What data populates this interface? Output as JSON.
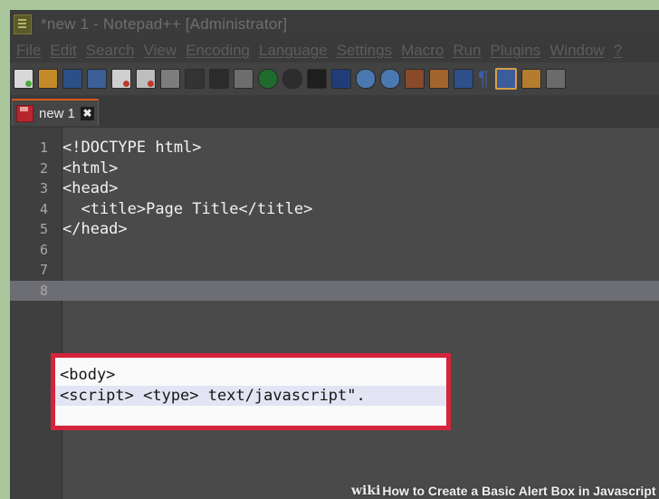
{
  "window": {
    "title": "*new 1 - Notepad++ [Administrator]"
  },
  "menu": [
    "File",
    "Edit",
    "Search",
    "View",
    "Encoding",
    "Language",
    "Settings",
    "Macro",
    "Run",
    "Plugins",
    "Window",
    "?"
  ],
  "toolbar": {
    "icons": [
      "new-file-icon",
      "open-file-icon",
      "save-icon",
      "save-all-icon",
      "close-icon",
      "close-all-icon",
      "print-icon",
      "cut-icon",
      "copy-icon",
      "paste-icon",
      "undo-icon",
      "redo-icon",
      "find-icon",
      "replace-icon",
      "zoom-in-icon",
      "zoom-out-icon",
      "sync-vertical-icon",
      "sync-horizontal-icon",
      "word-wrap-icon",
      "show-all-chars-icon",
      "indent-guide-icon",
      "user-language-icon",
      "macro-icon"
    ]
  },
  "tab": {
    "label": "new 1",
    "close_glyph": "✖"
  },
  "editor": {
    "lines": [
      {
        "number": "1",
        "text": "<!DOCTYPE html>"
      },
      {
        "number": "2",
        "text": "<html>"
      },
      {
        "number": "3",
        "text": "<head>"
      },
      {
        "number": "4",
        "text": "  <title>Page Title</title>"
      },
      {
        "number": "5",
        "text": "</head>"
      },
      {
        "number": "6",
        "text": ""
      },
      {
        "number": "7",
        "text": "<body>"
      },
      {
        "number": "8",
        "text": "<script> <type> text/javascript\"."
      }
    ],
    "current_line": "8"
  },
  "watermark": {
    "brand": "wiki",
    "text": "How to Create a Basic Alert Box in Javascript"
  },
  "colors": {
    "highlight_border": "#d6243a",
    "tab_accent": "#d65a1e",
    "background": "#a9c79a"
  }
}
